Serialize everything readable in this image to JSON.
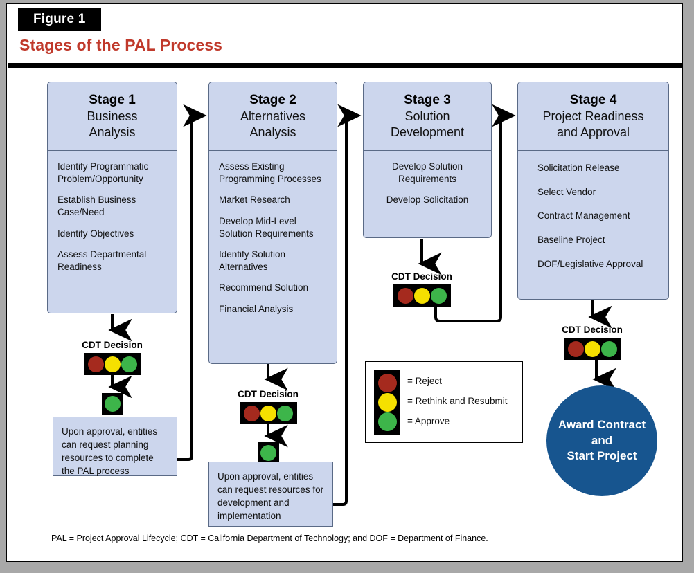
{
  "figure": {
    "tag": "Figure 1",
    "title": "Stages of the PAL Process",
    "footnote": "PAL = Project Approval Lifecycle; CDT = California Department of Technology; and DOF = Department of Finance."
  },
  "colors": {
    "title_red": "#c0392b",
    "stage_fill": "#ccd6ed",
    "stage_border": "#5a6a86",
    "reject_red": "#a52a1e",
    "rethink_yellow": "#f5e000",
    "approve_green": "#3db54a",
    "award_blue": "#17558f",
    "panel_background": "#ffffff",
    "page_background": "#a8a8a8"
  },
  "stages": [
    {
      "number": "Stage 1",
      "name": "Business\nAnalysis",
      "tasks": [
        "Identify Programmatic\nProblem/Opportunity",
        "Establish Business\nCase/Need",
        "Identify Objectives",
        "Assess Departmental\nReadiness"
      ]
    },
    {
      "number": "Stage 2",
      "name": "Alternatives\nAnalysis",
      "tasks": [
        "Assess Existing\nProgramming Processes",
        "Market Research",
        "Develop Mid-Level\nSolution Requirements",
        "Identify Solution\nAlternatives",
        "Recommend Solution",
        "Financial Analysis"
      ]
    },
    {
      "number": "Stage 3",
      "name": "Solution\nDevelopment",
      "tasks": [
        "Develop Solution\nRequirements",
        "Develop Solicitation"
      ]
    },
    {
      "number": "Stage 4",
      "name": "Project Readiness\nand Approval",
      "tasks": [
        "Solicitation Release",
        "Select Vendor",
        "Contract Management",
        "Baseline Project",
        "DOF/Legislative Approval"
      ]
    }
  ],
  "decisions": {
    "label": "CDT Decision"
  },
  "notes": [
    "Upon approval, entities can request planning resources to complete the  PAL process",
    "Upon approval, entities can request resources for development and implementation"
  ],
  "legend": {
    "rows": [
      "= Reject",
      "= Rethink and Resubmit",
      "= Approve"
    ]
  },
  "outcome": {
    "label": "Award Contract\nand\nStart Project"
  }
}
